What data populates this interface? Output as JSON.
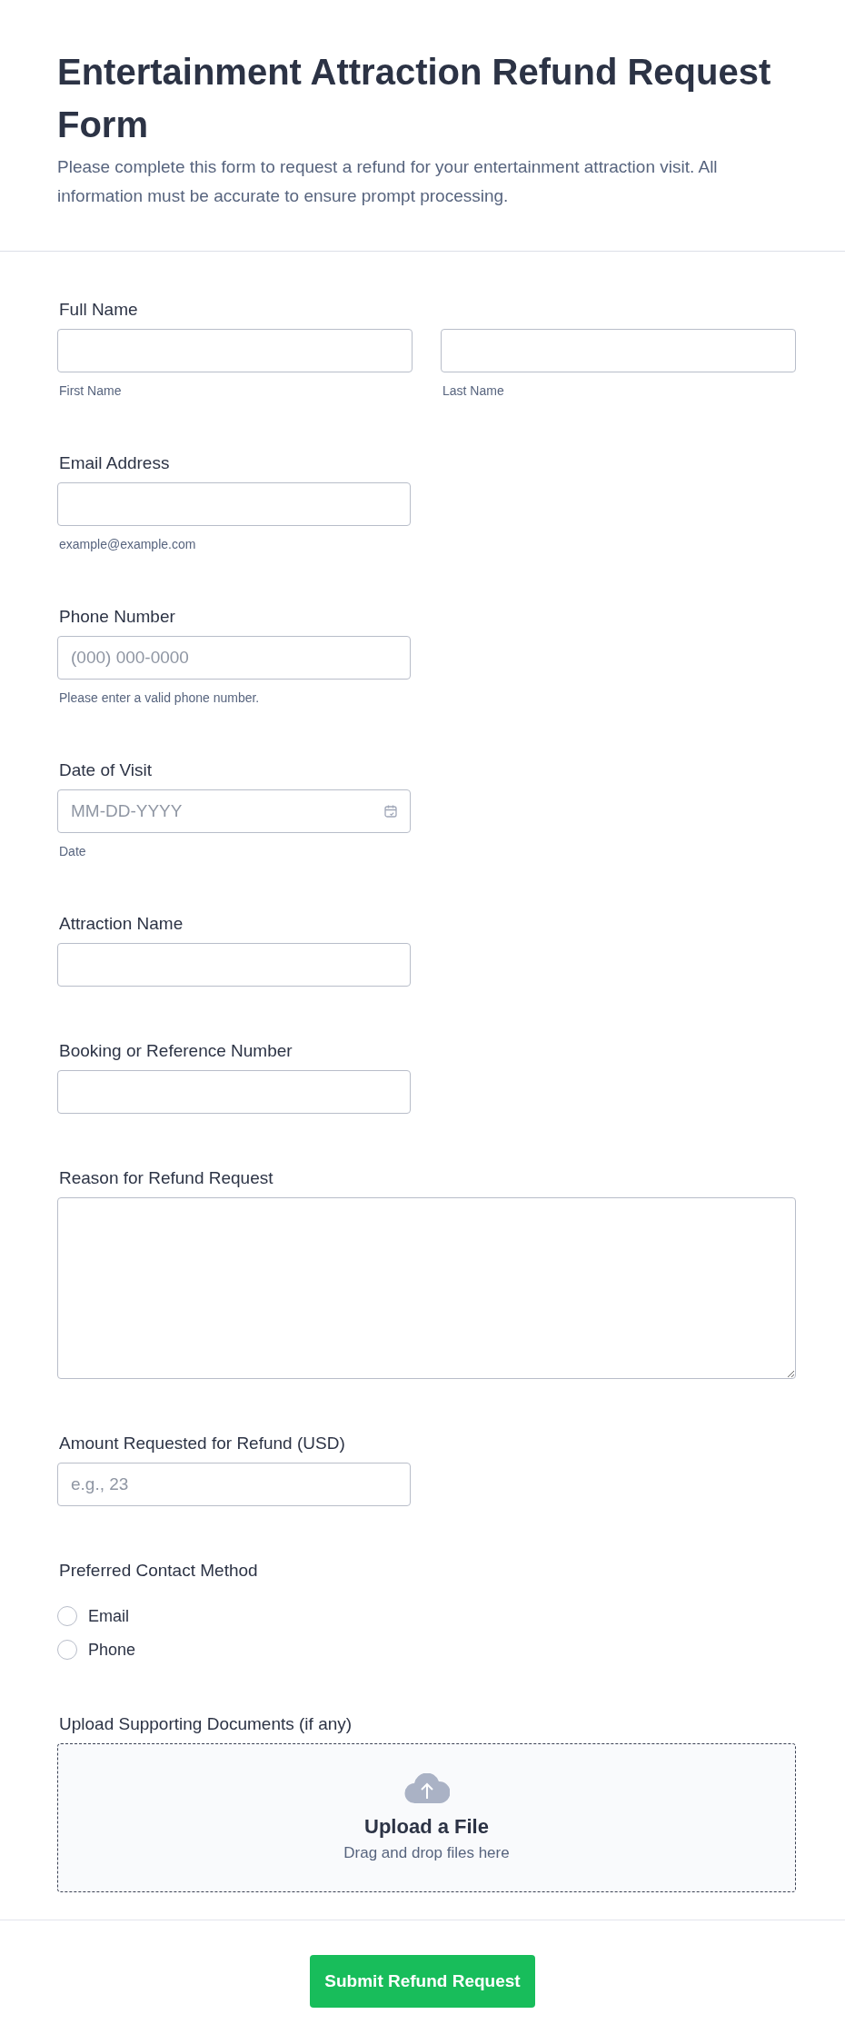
{
  "header": {
    "title": "Entertainment Attraction Refund Request Form",
    "description": "Please complete this form to request a refund for your entertainment attraction visit. All information must be accurate to ensure prompt processing."
  },
  "fields": [
    {
      "kind": "name",
      "label": "Full Name",
      "parts": [
        {
          "sublabel": "First Name"
        },
        {
          "sublabel": "Last Name"
        }
      ]
    },
    {
      "kind": "text",
      "label": "Email Address",
      "sublabel": "example@example.com"
    },
    {
      "kind": "text",
      "label": "Phone Number",
      "placeholder": "(000) 000-0000",
      "sublabel": "Please enter a valid phone number."
    },
    {
      "kind": "date",
      "label": "Date of Visit",
      "placeholder": "MM-DD-YYYY",
      "sublabel": "Date"
    },
    {
      "kind": "text",
      "label": "Attraction Name"
    },
    {
      "kind": "text",
      "label": "Booking or Reference Number"
    },
    {
      "kind": "textarea",
      "label": "Reason for Refund Request"
    },
    {
      "kind": "text",
      "label": "Amount Requested for Refund (USD)",
      "placeholder": "e.g., 23"
    },
    {
      "kind": "radio",
      "label": "Preferred Contact Method",
      "options": [
        {
          "label": "Email",
          "selected": false
        },
        {
          "label": "Phone",
          "selected": false
        }
      ]
    },
    {
      "kind": "upload",
      "label": "Upload Supporting Documents (if any)",
      "title": "Upload a File",
      "hint": "Drag and drop files here"
    }
  ],
  "submit": {
    "label": "Submit Refund Request"
  }
}
